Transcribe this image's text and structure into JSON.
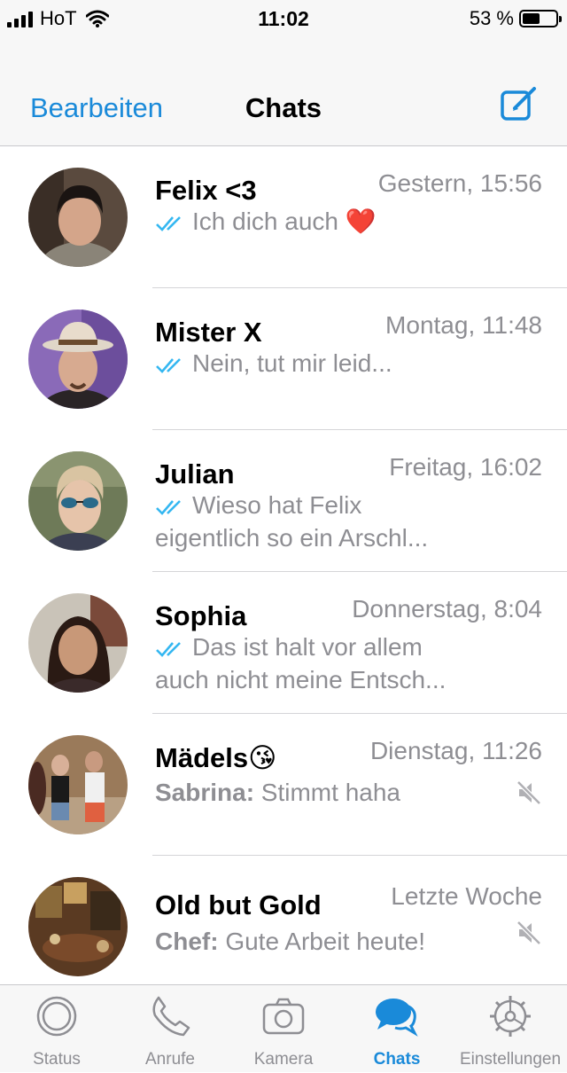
{
  "status_bar": {
    "carrier": "HoT",
    "time": "11:02",
    "battery": "53 %",
    "battery_level": 0.53
  },
  "nav": {
    "edit_label": "Bearbeiten",
    "title": "Chats"
  },
  "chats": [
    {
      "name": "Felix <3",
      "time": "Gestern, 15:56",
      "preview_line1": "Ich dich auch ❤️",
      "preview_line2": "",
      "read": true
    },
    {
      "name": "Mister X",
      "time": "Montag, 11:48",
      "preview_line1": "Nein, tut mir leid...",
      "preview_line2": "",
      "read": true
    },
    {
      "name": "Julian",
      "time": "Freitag, 16:02",
      "preview_line1": "Wieso hat Felix",
      "preview_line2": "eigentlich so ein Arschl...",
      "read": true
    },
    {
      "name": "Sophia",
      "time": "Donnerstag, 8:04",
      "preview_line1": "Das ist halt vor allem",
      "preview_line2": "auch nicht meine Entsch...",
      "read": true
    },
    {
      "name": "Mädels😘",
      "time": "Dienstag, 11:26",
      "sender": "Sabrina:",
      "preview_line1": " Stimmt haha",
      "muted": true
    },
    {
      "name": "Old but Gold",
      "time": "Letzte Woche",
      "sender": "Chef:",
      "preview_line1": " Gute Arbeit heute!",
      "muted": true
    }
  ],
  "tabs": [
    {
      "label": "Status",
      "icon": "status-icon",
      "active": false
    },
    {
      "label": "Anrufe",
      "icon": "phone-icon",
      "active": false
    },
    {
      "label": "Kamera",
      "icon": "camera-icon",
      "active": false
    },
    {
      "label": "Chats",
      "icon": "chats-icon",
      "active": true
    },
    {
      "label": "Einstellungen",
      "icon": "settings-icon",
      "active": false
    }
  ],
  "colors": {
    "accent": "#1a8ad9",
    "read_ticks": "#34b7f1",
    "secondary_text": "#8e8e93"
  }
}
